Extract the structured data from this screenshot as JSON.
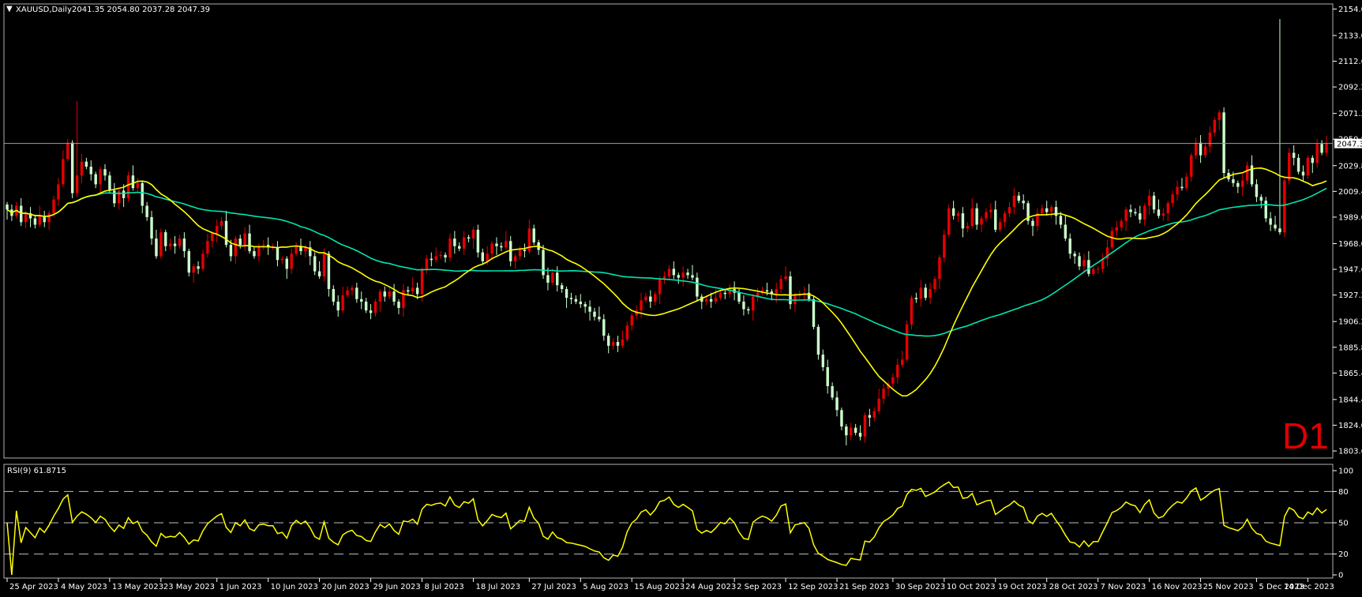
{
  "chart_data": {
    "type": "candlestick",
    "symbol_label": "XAUUSD,Daily",
    "ohlc_header": "2041.35 2054.80 2037.28 2047.39",
    "timeframe_badge": "D1",
    "current_price_label": "2047.39",
    "current_price": 2047.39,
    "y_tick_labels": [
      "2154.00",
      "2133.00",
      "2112.60",
      "2092.20",
      "2071.20",
      "2050.80",
      "2029.80",
      "2009.40",
      "1989.00",
      "1968.00",
      "1947.60",
      "1927.20",
      "1906.20",
      "1885.80",
      "1865.40",
      "1844.40",
      "1824.00",
      "1803.60"
    ],
    "ylim": [
      1798,
      2158
    ],
    "x_tick_labels": [
      "25 Apr 2023",
      "4 May 2023",
      "13 May 2023",
      "23 May 2023",
      "1 Jun 2023",
      "10 Jun 2023",
      "20 Jun 2023",
      "29 Jun 2023",
      "8 Jul 2023",
      "18 Jul 2023",
      "27 Jul 2023",
      "5 Aug 2023",
      "15 Aug 2023",
      "24 Aug 2023",
      "2 Sep 2023",
      "12 Sep 2023",
      "21 Sep 2023",
      "30 Sep 2023",
      "10 Oct 2023",
      "19 Oct 2023",
      "28 Oct 2023",
      "7 Nov 2023",
      "16 Nov 2023",
      "25 Nov 2023",
      "5 Dec 2023",
      "14 Dec 2023"
    ],
    "candle_colors": {
      "up": "#e60000",
      "down": "#ccffcc"
    },
    "ma_fast_color": "#ffff00",
    "ma_slow_color": "#00e6b0",
    "closes": [
      1995,
      1990,
      1998,
      1985,
      1992,
      1988,
      1983,
      1990,
      1985,
      1992,
      2003,
      2015,
      2035,
      2048,
      2008,
      2022,
      2033,
      2029,
      2023,
      2015,
      2027,
      2022,
      2010,
      2000,
      2010,
      2004,
      2022,
      2012,
      2016,
      1998,
      1989,
      1972,
      1958,
      1977,
      1966,
      1968,
      1966,
      1972,
      1962,
      1945,
      1950,
      1948,
      1960,
      1970,
      1976,
      1982,
      1986,
      1967,
      1958,
      1972,
      1967,
      1976,
      1962,
      1958,
      1966,
      1967,
      1965,
      1965,
      1955,
      1956,
      1948,
      1960,
      1966,
      1962,
      1965,
      1958,
      1946,
      1942,
      1960,
      1932,
      1922,
      1915,
      1927,
      1931,
      1933,
      1924,
      1922,
      1915,
      1913,
      1922,
      1930,
      1926,
      1930,
      1922,
      1917,
      1931,
      1930,
      1933,
      1928,
      1947,
      1956,
      1955,
      1958,
      1959,
      1957,
      1972,
      1966,
      1964,
      1973,
      1972,
      1979,
      1961,
      1954,
      1960,
      1968,
      1966,
      1965,
      1970,
      1954,
      1958,
      1963,
      1962,
      1980,
      1969,
      1963,
      1943,
      1937,
      1945,
      1935,
      1932,
      1925,
      1924,
      1922,
      1920,
      1918,
      1914,
      1910,
      1908,
      1895,
      1887,
      1890,
      1887,
      1892,
      1903,
      1911,
      1915,
      1923,
      1926,
      1922,
      1928,
      1940,
      1942,
      1948,
      1943,
      1941,
      1945,
      1943,
      1941,
      1926,
      1922,
      1924,
      1922,
      1925,
      1929,
      1928,
      1932,
      1929,
      1922,
      1916,
      1915,
      1926,
      1929,
      1931,
      1930,
      1928,
      1932,
      1940,
      1942,
      1920,
      1927,
      1928,
      1929,
      1924,
      1902,
      1880,
      1870,
      1855,
      1846,
      1836,
      1823,
      1816,
      1822,
      1818,
      1815,
      1832,
      1830,
      1835,
      1845,
      1853,
      1857,
      1862,
      1872,
      1876,
      1904,
      1925,
      1924,
      1933,
      1925,
      1932,
      1940,
      1957,
      1975,
      1996,
      1990,
      1992,
      1980,
      1982,
      1996,
      1983,
      1988,
      1993,
      1995,
      1979,
      1985,
      1992,
      1997,
      2006,
      2002,
      2000,
      1986,
      1982,
      1992,
      1996,
      1993,
      1997,
      1990,
      1983,
      1972,
      1960,
      1958,
      1950,
      1955,
      1944,
      1948,
      1948,
      1956,
      1965,
      1978,
      1981,
      1986,
      1995,
      1993,
      1992,
      1987,
      1998,
      2006,
      1995,
      1990,
      1992,
      2000,
      2007,
      2013,
      2012,
      2021,
      2038,
      2048,
      2038,
      2045,
      2056,
      2066,
      2072,
      2024,
      2019,
      2016,
      2013,
      2018,
      2030,
      2015,
      2005,
      2002,
      1988,
      1983,
      1980,
      1977,
      2018,
      2040,
      2036,
      2025,
      2022,
      2036,
      2032,
      2047,
      2040,
      2047.39
    ],
    "rsi_label": "RSI(9) 61.8715",
    "rsi_tick_labels": [
      "100",
      "80",
      "50",
      "20",
      "0"
    ],
    "rsi_levels": [
      20,
      50,
      80
    ],
    "rsi_color": "#ffff00"
  }
}
